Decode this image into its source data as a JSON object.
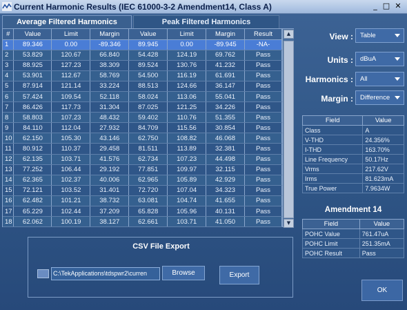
{
  "window": {
    "title": "Current Harmonic Results (IEC 61000-3-2 Amendment14, Class A)",
    "minimize_label": "_",
    "maximize_label": "□",
    "close_label": "✕"
  },
  "tabs": [
    {
      "label": "Average Filtered Harmonics"
    },
    {
      "label": "Peak Filtered Harmonics"
    }
  ],
  "table": {
    "headers": [
      "#",
      "Value",
      "Limit",
      "Margin",
      "Value",
      "Limit",
      "Margin",
      "Result"
    ],
    "rows": [
      [
        "1",
        "89.346",
        "0.00",
        "-89.346",
        "89.945",
        "0.00",
        "-89.945",
        "-NA-"
      ],
      [
        "2",
        "53.829",
        "120.67",
        "66.840",
        "54.428",
        "124.19",
        "69.762",
        "Pass"
      ],
      [
        "3",
        "88.925",
        "127.23",
        "38.309",
        "89.524",
        "130.76",
        "41.232",
        "Pass"
      ],
      [
        "4",
        "53.901",
        "112.67",
        "58.769",
        "54.500",
        "116.19",
        "61.691",
        "Pass"
      ],
      [
        "5",
        "87.914",
        "121.14",
        "33.224",
        "88.513",
        "124.66",
        "36.147",
        "Pass"
      ],
      [
        "6",
        "57.424",
        "109.54",
        "52.118",
        "58.024",
        "113.06",
        "55.041",
        "Pass"
      ],
      [
        "7",
        "86.426",
        "117.73",
        "31.304",
        "87.025",
        "121.25",
        "34.226",
        "Pass"
      ],
      [
        "8",
        "58.803",
        "107.23",
        "48.432",
        "59.402",
        "110.76",
        "51.355",
        "Pass"
      ],
      [
        "9",
        "84.110",
        "112.04",
        "27.932",
        "84.709",
        "115.56",
        "30.854",
        "Pass"
      ],
      [
        "10",
        "62.150",
        "105.30",
        "43.146",
        "62.750",
        "108.82",
        "46.068",
        "Pass"
      ],
      [
        "11",
        "80.912",
        "110.37",
        "29.458",
        "81.511",
        "113.89",
        "32.381",
        "Pass"
      ],
      [
        "12",
        "62.135",
        "103.71",
        "41.576",
        "62.734",
        "107.23",
        "44.498",
        "Pass"
      ],
      [
        "13",
        "77.252",
        "106.44",
        "29.192",
        "77.851",
        "109.97",
        "32.115",
        "Pass"
      ],
      [
        "14",
        "62.365",
        "102.37",
        "40.006",
        "62.965",
        "105.89",
        "42.929",
        "Pass"
      ],
      [
        "15",
        "72.121",
        "103.52",
        "31.401",
        "72.720",
        "107.04",
        "34.323",
        "Pass"
      ],
      [
        "16",
        "62.482",
        "101.21",
        "38.732",
        "63.081",
        "104.74",
        "41.655",
        "Pass"
      ],
      [
        "17",
        "65.229",
        "102.44",
        "37.209",
        "65.828",
        "105.96",
        "40.131",
        "Pass"
      ],
      [
        "18",
        "62.062",
        "100.19",
        "38.127",
        "62.661",
        "103.71",
        "41.050",
        "Pass"
      ]
    ]
  },
  "controls": {
    "view": {
      "label": "View :",
      "value": "Table"
    },
    "units": {
      "label": "Units :",
      "value": "dBuA"
    },
    "harmonics": {
      "label": "Harmonics :",
      "value": "All"
    },
    "margin": {
      "label": "Margin :",
      "value": "Difference"
    }
  },
  "measurements": {
    "headers": [
      "Field",
      "Value"
    ],
    "rows": [
      [
        "Class",
        "A"
      ],
      [
        "V-THD",
        "24.356%"
      ],
      [
        "I-THD",
        "163.70%"
      ],
      [
        "Line Frequency",
        "50.17Hz"
      ],
      [
        "Vrms",
        "217.62V"
      ],
      [
        "Irms",
        "81.623mA"
      ],
      [
        "True Power",
        "7.9634W"
      ]
    ]
  },
  "amendment": {
    "title": "Amendment 14",
    "headers": [
      "Field",
      "Value"
    ],
    "rows": [
      [
        "POHC Value",
        "761.47uA"
      ],
      [
        "POHC Limit",
        "251.35mA"
      ],
      [
        "POHC Result",
        "Pass"
      ]
    ]
  },
  "csv_export": {
    "title": "CSV File Export",
    "path": "C:\\TekApplications\\tdspwr2\\curren",
    "browse_label": "Browse",
    "export_label": "Export"
  },
  "ok_label": "OK"
}
